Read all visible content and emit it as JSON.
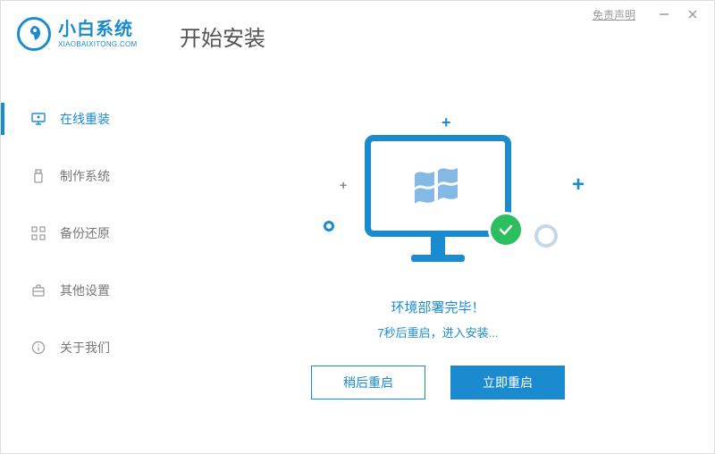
{
  "titlebar": {
    "disclaimer": "免责声明"
  },
  "brand": {
    "name": "小白系统",
    "url": "XIAOBAIXITONG.COM"
  },
  "page_title": "开始安装",
  "sidebar": {
    "items": [
      {
        "label": "在线重装"
      },
      {
        "label": "制作系统"
      },
      {
        "label": "备份还原"
      },
      {
        "label": "其他设置"
      },
      {
        "label": "关于我们"
      }
    ]
  },
  "status": {
    "main": "环境部署完毕！",
    "sub": "7秒后重启，进入安装..."
  },
  "buttons": {
    "later": "稍后重启",
    "now": "立即重启"
  }
}
